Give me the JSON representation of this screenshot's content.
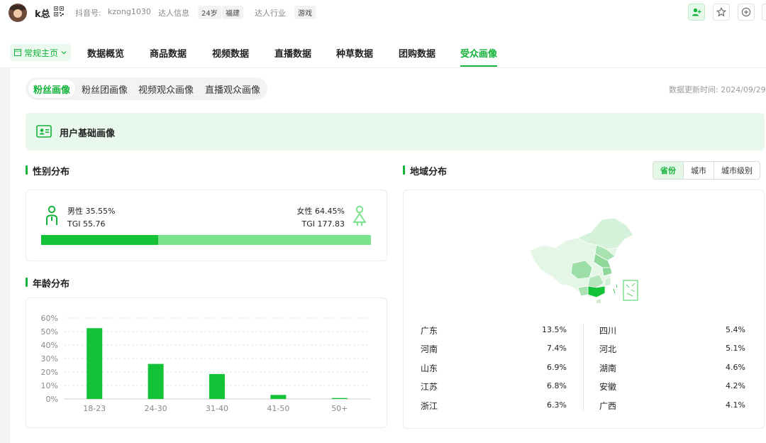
{
  "header": {
    "username": "k总",
    "douyin_id_label": "抖音号:",
    "douyin_id": "kzong1030",
    "profile_label": "达人信息",
    "age_tag": "24岁",
    "location_tag": "福建",
    "industry_label": "达人行业",
    "industry_tag": "游戏"
  },
  "nav": {
    "home_label": "常规主页",
    "items": [
      "数据概览",
      "商品数据",
      "视频数据",
      "直播数据",
      "种草数据",
      "团购数据",
      "受众画像"
    ],
    "active": "受众画像"
  },
  "subtabs": {
    "items": [
      "粉丝画像",
      "粉丝团画像",
      "视频观众画像",
      "直播观众画像"
    ],
    "active": "粉丝画像"
  },
  "update_time": "数据更新时间: 2024/09/29",
  "banner_title": "用户基础画像",
  "gender": {
    "title": "性别分布",
    "male_label": "男性 35.55%",
    "male_tgi": "TGI 55.76",
    "female_label": "女性 64.45%",
    "female_tgi": "TGI 177.83",
    "male_share": 35.55,
    "female_share": 64.45,
    "male_color": "#13c237",
    "female_color": "#7be38c"
  },
  "age": {
    "title": "年龄分布"
  },
  "chart_data": {
    "type": "bar",
    "categories": [
      "18-23",
      "24-30",
      "31-40",
      "41-50",
      "50+"
    ],
    "values": [
      52.5,
      26,
      18.5,
      3,
      0.7
    ],
    "ylim": [
      0,
      60
    ],
    "yticks": [
      "0%",
      "10%",
      "20%",
      "30%",
      "40%",
      "50%",
      "60%"
    ],
    "grid": true,
    "color": "#13c237"
  },
  "region": {
    "title": "地域分布",
    "tabs": [
      "省份",
      "城市",
      "城市级别"
    ],
    "active_tab": "省份",
    "left": [
      {
        "name": "广东",
        "value": "13.5%"
      },
      {
        "name": "河南",
        "value": "7.4%"
      },
      {
        "name": "山东",
        "value": "6.9%"
      },
      {
        "name": "江苏",
        "value": "6.8%"
      },
      {
        "name": "浙江",
        "value": "6.3%"
      }
    ],
    "right": [
      {
        "name": "四川",
        "value": "5.4%"
      },
      {
        "name": "河北",
        "value": "5.1%"
      },
      {
        "name": "湖南",
        "value": "4.6%"
      },
      {
        "name": "安徽",
        "value": "4.2%"
      },
      {
        "name": "广西",
        "value": "4.1%"
      }
    ]
  }
}
